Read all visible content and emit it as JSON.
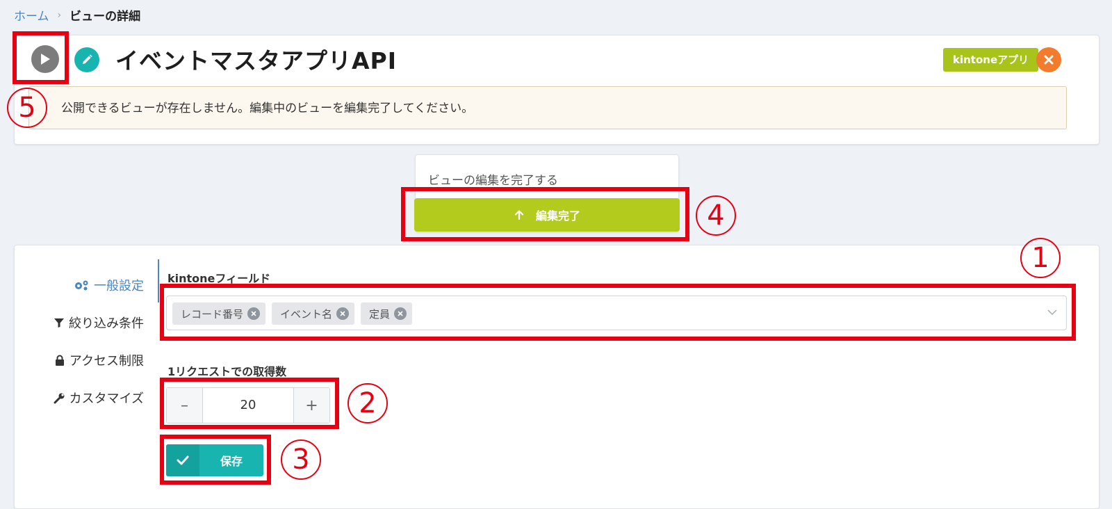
{
  "breadcrumb": {
    "home": "ホーム",
    "separator": "›",
    "current": "ビューの詳細"
  },
  "header": {
    "title": "イベントマスタアプリAPI",
    "badge": "kintoneアプリ",
    "alert": "公開できるビューが存在しません。編集中のビューを編集完了してください。",
    "icons": [
      "play-icon",
      "pencil-icon",
      "close-icon"
    ]
  },
  "publish": {
    "description": "ビューの編集を完了する",
    "button_label": "編集完了",
    "button_icon": "arrow-up-icon"
  },
  "sidebar": {
    "items": [
      {
        "label": "一般設定",
        "icon": "gears-icon",
        "active": true
      },
      {
        "label": "絞り込み条件",
        "icon": "filter-icon",
        "active": false
      },
      {
        "label": "アクセス制限",
        "icon": "lock-icon",
        "active": false
      },
      {
        "label": "カスタマイズ",
        "icon": "wrench-icon",
        "active": false
      }
    ]
  },
  "general": {
    "fields_label": "kintoneフィールド",
    "fields": [
      "レコード番号",
      "イベント名",
      "定員"
    ],
    "count_label": "1リクエストでの取得数",
    "count_value": "20",
    "minus": "–",
    "plus": "+",
    "save_label": "保存"
  },
  "annotations": [
    "1",
    "2",
    "3",
    "4",
    "5"
  ],
  "colors": {
    "accent_green": "#b2cb1d",
    "teal": "#18b4b0",
    "orange": "#f27b2c",
    "annotation_red": "#e60012",
    "link_blue": "#4a86c5"
  }
}
